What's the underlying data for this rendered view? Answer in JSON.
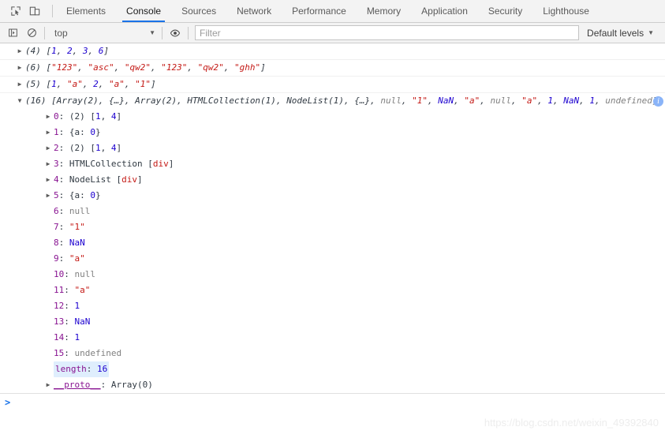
{
  "toolbar": {
    "inspect_icon": "inspect-element-icon",
    "device_icon": "device-toolbar-icon",
    "tabs": [
      {
        "label": "Elements",
        "active": false
      },
      {
        "label": "Console",
        "active": true
      },
      {
        "label": "Sources",
        "active": false
      },
      {
        "label": "Network",
        "active": false
      },
      {
        "label": "Performance",
        "active": false
      },
      {
        "label": "Memory",
        "active": false
      },
      {
        "label": "Application",
        "active": false
      },
      {
        "label": "Security",
        "active": false
      },
      {
        "label": "Lighthouse",
        "active": false
      }
    ]
  },
  "filterbar": {
    "sidebar_icon": "console-sidebar-icon",
    "clear_icon": "clear-console-icon",
    "context_value": "top",
    "context_caret": "▼",
    "eye_icon": "live-expression-eye-icon",
    "filter_placeholder": "Filter",
    "filter_value": "",
    "levels_label": "Default levels",
    "levels_caret": "▼"
  },
  "console": {
    "rows": [
      {
        "arrow": "▶",
        "count": "(4)",
        "text": "[1, 2, 3, 6]"
      },
      {
        "arrow": "▶",
        "count": "(6)",
        "text": "[\"123\", \"asc\", \"qw2\", \"123\", \"qw2\", \"ghh\"]"
      },
      {
        "arrow": "▶",
        "count": "(5)",
        "text": "[1, \"a\", 2, \"a\", \"1\"]"
      }
    ],
    "expanded": {
      "arrow": "▼",
      "count": "(16)",
      "summary": "[Array(2), {…}, Array(2), HTMLCollection(1), NodeList(1), {…}, null, \"1\", NaN, \"a\", null, \"a\", 1, NaN, 1, undefined]",
      "info_badge": "i",
      "entries": [
        {
          "arrow": "▶",
          "key": "0",
          "value": "(2) [1, 4]"
        },
        {
          "arrow": "▶",
          "key": "1",
          "value": "{a: 0}"
        },
        {
          "arrow": "▶",
          "key": "2",
          "value": "(2) [1, 4]"
        },
        {
          "arrow": "▶",
          "key": "3",
          "value": "HTMLCollection [div]"
        },
        {
          "arrow": "▶",
          "key": "4",
          "value": "NodeList [div]"
        },
        {
          "arrow": "▶",
          "key": "5",
          "value": "{a: 0}"
        },
        {
          "arrow": "",
          "key": "6",
          "value": "null"
        },
        {
          "arrow": "",
          "key": "7",
          "value": "\"1\""
        },
        {
          "arrow": "",
          "key": "8",
          "value": "NaN"
        },
        {
          "arrow": "",
          "key": "9",
          "value": "\"a\""
        },
        {
          "arrow": "",
          "key": "10",
          "value": "null"
        },
        {
          "arrow": "",
          "key": "11",
          "value": "\"a\""
        },
        {
          "arrow": "",
          "key": "12",
          "value": "1"
        },
        {
          "arrow": "",
          "key": "13",
          "value": "NaN"
        },
        {
          "arrow": "",
          "key": "14",
          "value": "1"
        },
        {
          "arrow": "",
          "key": "15",
          "value": "undefined"
        }
      ],
      "length_key": "length",
      "length_value": "16",
      "proto_arrow": "▶",
      "proto_key": "__proto__",
      "proto_value": "Array(0)"
    },
    "prompt_chevron": ">"
  },
  "watermark": "https://blog.csdn.net/weixin_49392840",
  "colors": {
    "accent": "#1a73e8",
    "string": "#c41a16",
    "number": "#1c00cf",
    "key": "#881391",
    "null": "#808080",
    "toolbar_bg": "#f3f3f3",
    "highlight": "#dfeefd"
  }
}
